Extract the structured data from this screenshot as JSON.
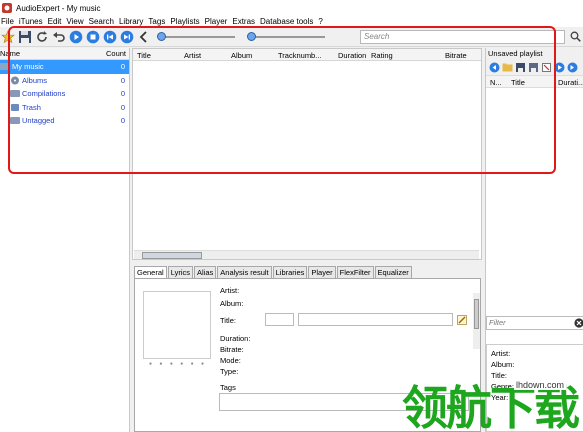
{
  "window": {
    "title": "AudioExpert - My music"
  },
  "menu": [
    "File",
    "iTunes",
    "Edit",
    "View",
    "Search",
    "Library",
    "Tags",
    "Playlists",
    "Player",
    "Extras",
    "Database tools",
    "?"
  ],
  "toolbar": {
    "search_placeholder": "Search"
  },
  "tree": {
    "col_name": "Name",
    "col_count": "Count",
    "items": [
      {
        "label": "My music",
        "count": "0",
        "selected": true
      },
      {
        "label": "Albums",
        "count": "0"
      },
      {
        "label": "Compilations",
        "count": "0"
      },
      {
        "label": "Trash",
        "count": "0"
      },
      {
        "label": "Untagged",
        "count": "0"
      }
    ]
  },
  "tracklist": {
    "columns": [
      "Title",
      "Artist",
      "Album",
      "Tracknumb...",
      "Duration",
      "Rating",
      "Bitrate"
    ]
  },
  "details": {
    "tabs": [
      "General",
      "Lyrics",
      "Alias",
      "Analysis result",
      "Libraries",
      "Player",
      "FlexFilter",
      "Equalizer"
    ],
    "active_tab": "General",
    "labels": {
      "artist": "Artist:",
      "album": "Album:",
      "title": "Title:",
      "duration": "Duration:",
      "bitrate": "Bitrate:",
      "mode": "Mode:",
      "type": "Type:",
      "tags": "Tags"
    }
  },
  "playlist": {
    "title": "Unsaved playlist",
    "columns": [
      "N...",
      "Title",
      "Durati..."
    ],
    "filter_placeholder": "Filter",
    "info": [
      "Artist:",
      "Album:",
      "Title:",
      "Genre:",
      "Year:"
    ]
  },
  "watermark": {
    "text": "领航下载",
    "url": "lhdown.com"
  },
  "colors": {
    "selection": "#3399ff",
    "link": "#1f3fc8",
    "highlight_border": "#e01818",
    "watermark": "#1ea61e"
  }
}
